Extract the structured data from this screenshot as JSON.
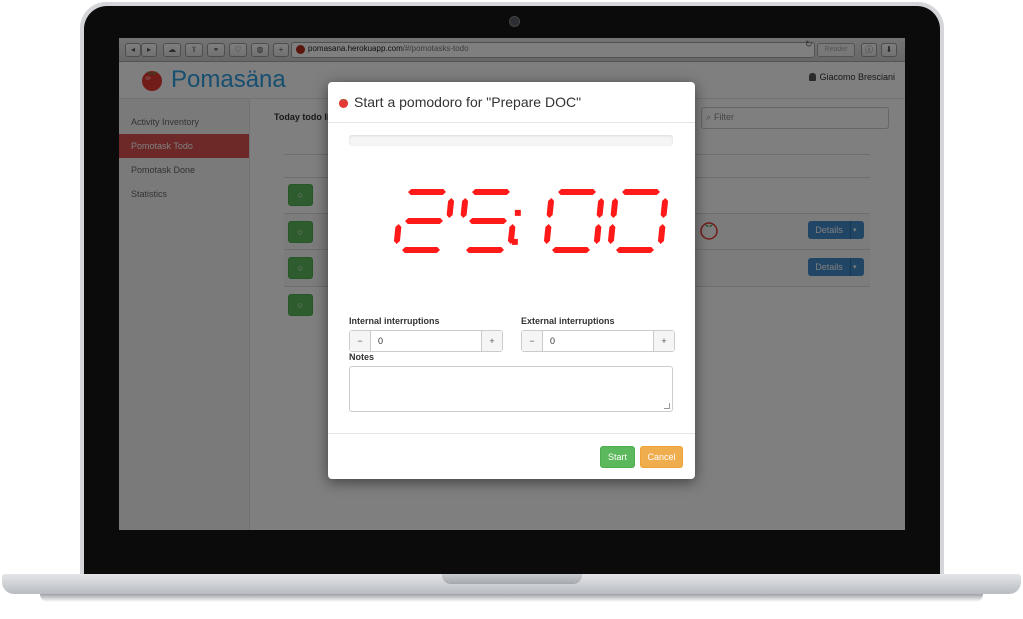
{
  "browser": {
    "url_host": "pomasana.herokuapp.com",
    "url_path": "/#/pomotasks-todo",
    "reader_label": "Reader",
    "reload_glyph": "↻"
  },
  "app": {
    "name": "Pomasäna",
    "user": "Giacomo Bresciani",
    "brand_color": "#2f9fe0",
    "accent_color": "#d9534f"
  },
  "sidebar": {
    "items": [
      {
        "label": "Activity Inventory",
        "active": false
      },
      {
        "label": "Pomotask Todo",
        "active": true
      },
      {
        "label": "Pomotask Done",
        "active": false
      },
      {
        "label": "Statistics",
        "active": false
      }
    ]
  },
  "main": {
    "title": "Today todo lis",
    "filter_placeholder": "Filter",
    "check_glyph": "○",
    "details_label": "Details",
    "details_caret": "▾"
  },
  "modal": {
    "icon": "tomato-icon",
    "title": "Start a pomodoro for \"Prepare DOC\"",
    "progress": 0,
    "timer": {
      "minutes": "25",
      "seconds": "00",
      "color": "#ff1a1a"
    },
    "internal_label": "Internal interruptions",
    "internal_value": "0",
    "external_label": "External interruptions",
    "external_value": "0",
    "minus_glyph": "−",
    "plus_glyph": "+",
    "notes_label": "Notes",
    "start_label": "Start",
    "cancel_label": "Cancel"
  }
}
